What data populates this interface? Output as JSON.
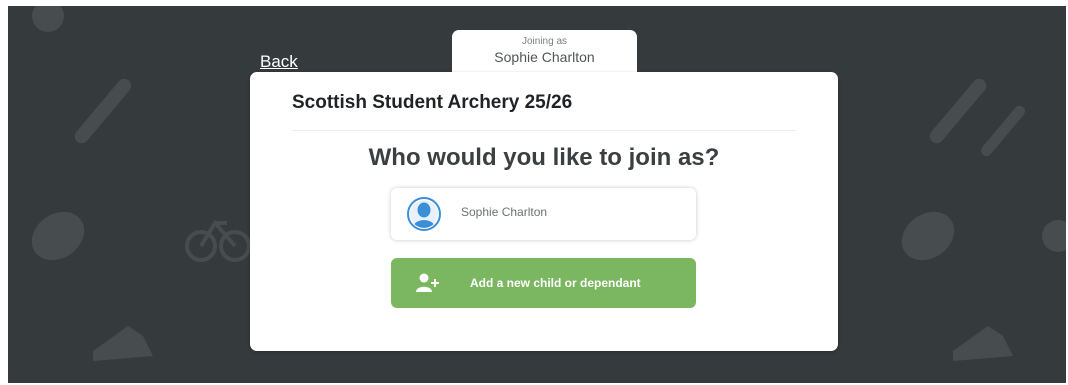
{
  "nav": {
    "back_label": "Back"
  },
  "joining": {
    "caption": "Joining as",
    "name": "Sophie Charlton"
  },
  "card": {
    "title": "Scottish Student Archery 25/26",
    "question": "Who would you like to join as?"
  },
  "options": {
    "person_name": "Sophie Charlton",
    "add_dependant_label": "Add a new child or dependant"
  },
  "colors": {
    "background": "#353a3d",
    "accent_green": "#7bb661",
    "avatar_blue": "#3a8fd6"
  },
  "icons": {
    "avatar": "user-avatar-icon",
    "add_user": "add-user-icon"
  }
}
